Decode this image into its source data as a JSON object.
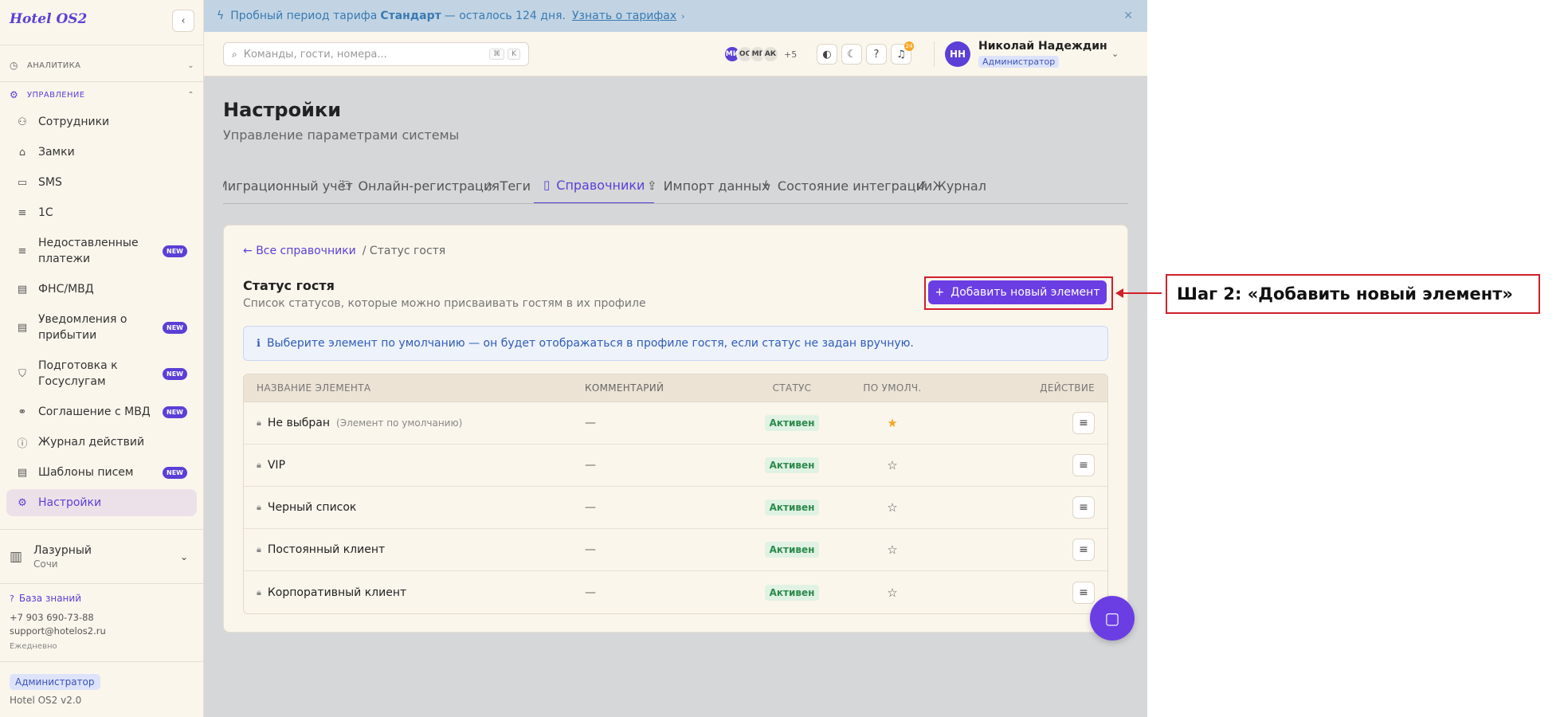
{
  "app": {
    "logo": "Hotel OS2"
  },
  "sidebar": {
    "sections": [
      {
        "label": "АНАЛИТИКА",
        "icon": "clock-icon"
      },
      {
        "label": "УПРАВЛЕНИЕ",
        "icon": "gear-icon"
      }
    ],
    "items": [
      {
        "label": "Сотрудники",
        "icon": "user-icon",
        "badge": ""
      },
      {
        "label": "Замки",
        "icon": "lock-icon",
        "badge": ""
      },
      {
        "label": "SMS",
        "icon": "message-icon",
        "badge": ""
      },
      {
        "label": "1С",
        "icon": "database-icon",
        "badge": ""
      },
      {
        "label": "Недоставленные платежи",
        "icon": "database-icon",
        "badge": "NEW"
      },
      {
        "label": "ФНС/МВД",
        "icon": "document-icon",
        "badge": ""
      },
      {
        "label": "Уведомления о прибытии",
        "icon": "document-icon",
        "badge": "NEW"
      },
      {
        "label": "Подготовка к Госуслугам",
        "icon": "shield-icon",
        "badge": "NEW"
      },
      {
        "label": "Соглашение с МВД",
        "icon": "handshake-icon",
        "badge": "NEW"
      },
      {
        "label": "Журнал действий",
        "icon": "alert-icon",
        "badge": ""
      },
      {
        "label": "Шаблоны писем",
        "icon": "document-icon",
        "badge": "NEW"
      },
      {
        "label": "Настройки",
        "icon": "gear-icon",
        "badge": ""
      }
    ],
    "hotel": {
      "name": "Лазурный",
      "city": "Сочи"
    },
    "knowledge_base": "База знаний",
    "phone": "+7 903 690-73-88",
    "email": "support@hotelos2.ru",
    "schedule": "Ежедневно",
    "role": "Администратор",
    "version": "Hotel OS2 v2.0"
  },
  "promo": {
    "text_before": "Пробный период тарифа",
    "plan": "Стандарт",
    "text_after": "— осталось 124 дня.",
    "link": "Узнать о тарифах"
  },
  "topbar": {
    "search_placeholder": "Команды, гости, номера...",
    "kbd": [
      "⌘",
      "K"
    ],
    "avatars": [
      "МИ",
      "ОС",
      "МГ",
      "АК"
    ],
    "avatars_more": "+5",
    "notifications_count": "24",
    "user_initials": "НН",
    "user_name": "Николай Надеждин",
    "user_role": "Администратор"
  },
  "page": {
    "title": "Настройки",
    "subtitle": "Управление параметрами системы",
    "tabs": [
      {
        "label": "Миграционный учёт",
        "icon": ""
      },
      {
        "label": "Онлайн-регистрация",
        "icon": "user-check-icon"
      },
      {
        "label": "Теги",
        "icon": "tag-icon"
      },
      {
        "label": "Справочники",
        "icon": "book-icon"
      },
      {
        "label": "Импорт данных",
        "icon": "upload-icon"
      },
      {
        "label": "Состояние интеграции",
        "icon": "bolt-icon"
      },
      {
        "label": "Журнал",
        "icon": "history-icon"
      }
    ]
  },
  "card": {
    "back_link": "Все справочники",
    "crumb_current": "/ Статус гостя",
    "title": "Статус гостя",
    "subtitle": "Список статусов, которые можно присваивать гостям в их профиле",
    "add_button": "Добавить новый элемент",
    "info": "Выберите элемент по умолчанию — он будет отображаться в профиле гостя, если статус не задан вручную.",
    "columns": [
      "НАЗВАНИЕ ЭЛЕМЕНТА",
      "КОММЕНТАРИЙ",
      "СТАТУС",
      "ПО УМОЛЧ.",
      "ДЕЙСТВИЕ"
    ],
    "rows": [
      {
        "name": "Не выбран",
        "note": "(Элемент по умолчанию)",
        "comment": "—",
        "status": "Активен",
        "default": true
      },
      {
        "name": "VIP",
        "note": "",
        "comment": "—",
        "status": "Активен",
        "default": false
      },
      {
        "name": "Черный список",
        "note": "",
        "comment": "—",
        "status": "Активен",
        "default": false
      },
      {
        "name": "Постоянный клиент",
        "note": "",
        "comment": "—",
        "status": "Активен",
        "default": false
      },
      {
        "name": "Корпоративный клиент",
        "note": "",
        "comment": "—",
        "status": "Активен",
        "default": false
      }
    ]
  },
  "annotation": {
    "text": "Шаг 2: «Добавить новый элемент»",
    "color": "#d0202a"
  },
  "colors": {
    "accent": "#6a3ee3",
    "sidebar_bg": "#fbf6ec",
    "overlay": "#d6d7d9"
  }
}
